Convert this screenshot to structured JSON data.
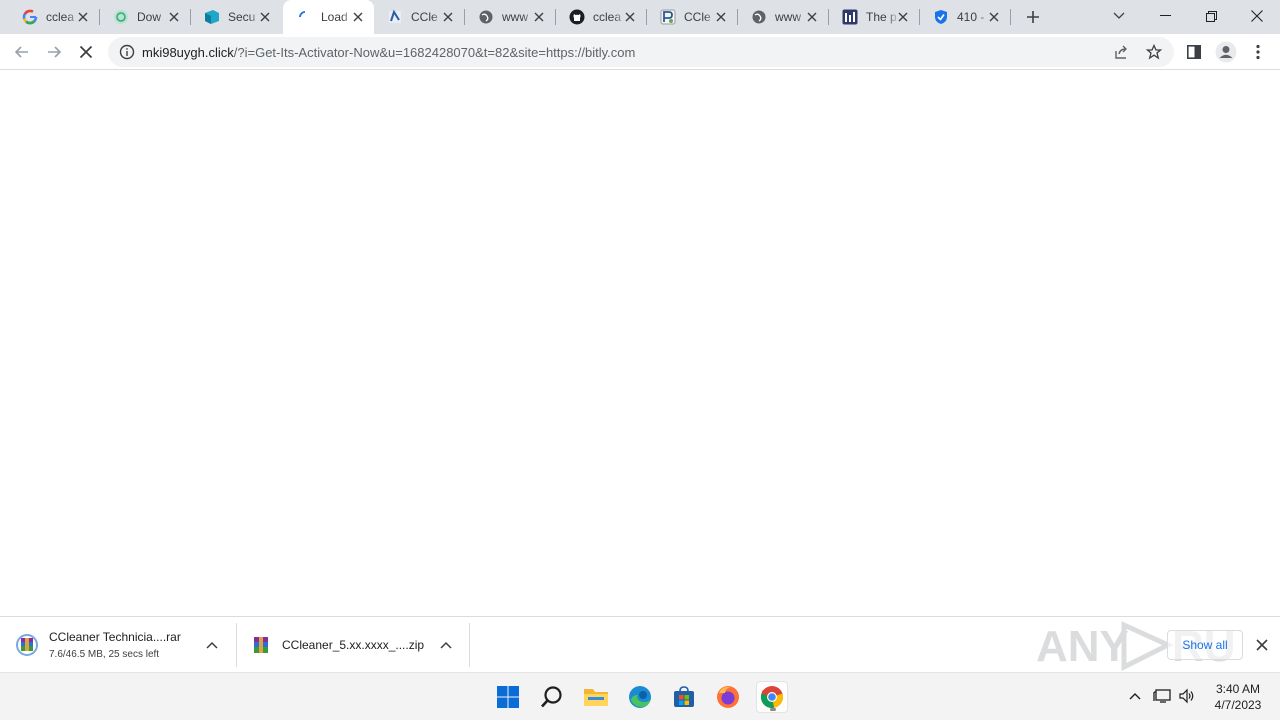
{
  "browser": {
    "tabs": [
      {
        "title": "cclea",
        "icon": "google-icon",
        "active": false
      },
      {
        "title": "Dow",
        "icon": "download-site-icon",
        "active": false
      },
      {
        "title": "Secu",
        "icon": "security-site-icon",
        "active": false
      },
      {
        "title": "Load",
        "icon": "loading-spinner-icon",
        "active": true
      },
      {
        "title": "CCle",
        "icon": "ccleaner-site-icon",
        "active": false
      },
      {
        "title": "www",
        "icon": "globe-icon",
        "active": false
      },
      {
        "title": "cclea",
        "icon": "github-icon",
        "active": false
      },
      {
        "title": "CCle",
        "icon": "parsec-site-icon",
        "active": false
      },
      {
        "title": "www",
        "icon": "globe-icon",
        "active": false
      },
      {
        "title": "The p",
        "icon": "hub-site-icon",
        "active": false
      },
      {
        "title": "410 -",
        "icon": "shield-site-icon",
        "active": false
      }
    ],
    "address": {
      "host": "mki98uygh.click",
      "path": "/?i=Get-Its-Activator-Now&u=1682428070&t=82&site=https://bitly.com"
    }
  },
  "downloads": {
    "items": [
      {
        "name": "CCleaner Technicia....rar",
        "status": "7.6/46.5 MB, 25 secs left",
        "icon": "winrar-archive-icon"
      },
      {
        "name": "CCleaner_5.xx.xxxx_....zip",
        "status": "",
        "icon": "winrar-archive-icon"
      }
    ],
    "show_all_label": "Show all",
    "watermark_text": "ANY RUN"
  },
  "taskbar": {
    "apps": [
      "windows-start-icon",
      "search-icon",
      "file-explorer-icon",
      "edge-icon",
      "microsoft-store-icon",
      "firefox-icon",
      "chrome-icon"
    ],
    "time": "3:40 AM",
    "date": "4/7/2023"
  },
  "colors": {
    "tabstrip": "#dee1e6",
    "omnibox": "#f1f3f4",
    "link_blue": "#1a73e8",
    "taskbar": "#f3f3f3"
  }
}
